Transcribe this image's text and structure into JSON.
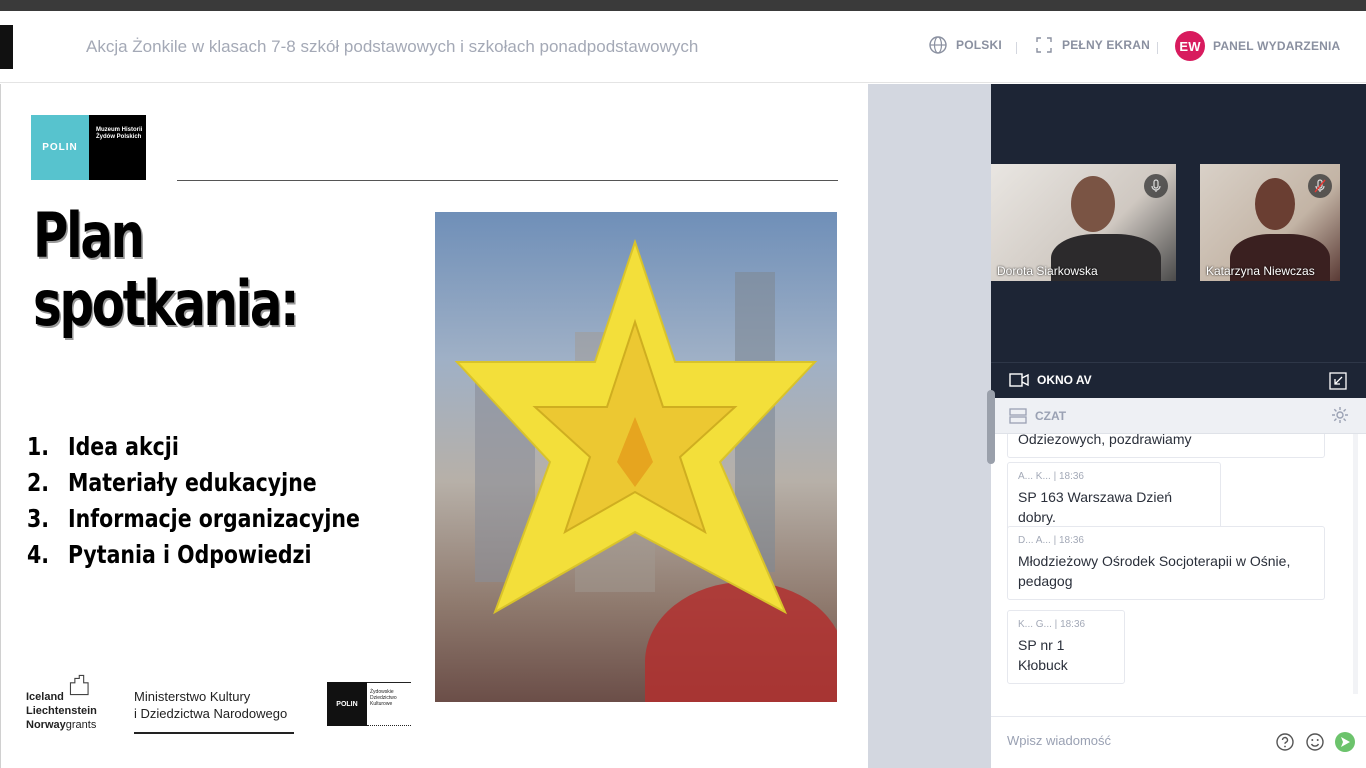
{
  "header": {
    "title": "Akcja Żonkile w klasach 7-8 szkół podstawowych i szkołach ponadpodstawowych",
    "language_label": "POLSKI",
    "fullscreen_label": "PEŁNY EKRAN",
    "avatar_initials": "EW",
    "event_panel_label": "PANEL WYDARZENIA",
    "avatar_color": "#d81b5e"
  },
  "slide": {
    "logo_text": "POLIN",
    "logo_caption": "Muzeum Historii Żydów Polskich",
    "heading_line1": "Plan",
    "heading_line2": "spotkania:",
    "agenda": [
      {
        "num": "1.",
        "text": "Idea akcji"
      },
      {
        "num": "2.",
        "text": "Materiały edukacyjne"
      },
      {
        "num": "3.",
        "text": "Informacje organizacyjne"
      },
      {
        "num": "4.",
        "text": "Pytania i Odpowiedzi"
      }
    ],
    "footer": {
      "grants_line1": "Iceland",
      "grants_line2": "Liechtenstein",
      "grants_line3a": "Norway",
      "grants_line3b": "grants",
      "ministry_line1": "Ministerstwo Kultury",
      "ministry_line2": "i Dziedzictwa Narodowego",
      "polin_small": "POLIN",
      "polin_small_caption": "Żydowskie Dziedzictwo Kulturowe"
    }
  },
  "video": {
    "participants": [
      {
        "name": "Dorota Siarkowska",
        "mic": "on"
      },
      {
        "name": "Katarzyna Niewczas",
        "mic": "muted"
      }
    ],
    "av_window_label": "OKNO AV"
  },
  "chat": {
    "title": "CZAT",
    "partial_message": "Odziezowych, pozdrawiamy",
    "messages": [
      {
        "author": "A... K...",
        "time": "18:36",
        "text": "SP 163 Warszawa Dzień dobry."
      },
      {
        "author": "D... A...",
        "time": "18:36",
        "text": "Młodzieżowy Ośrodek Socjoterapii w Ośnie, pedagog"
      },
      {
        "author": "K... G...",
        "time": "18:36",
        "text": "SP nr 1 Kłobuck"
      }
    ],
    "input_placeholder": "Wpisz wiadomość",
    "send_color": "#6cc36c"
  }
}
